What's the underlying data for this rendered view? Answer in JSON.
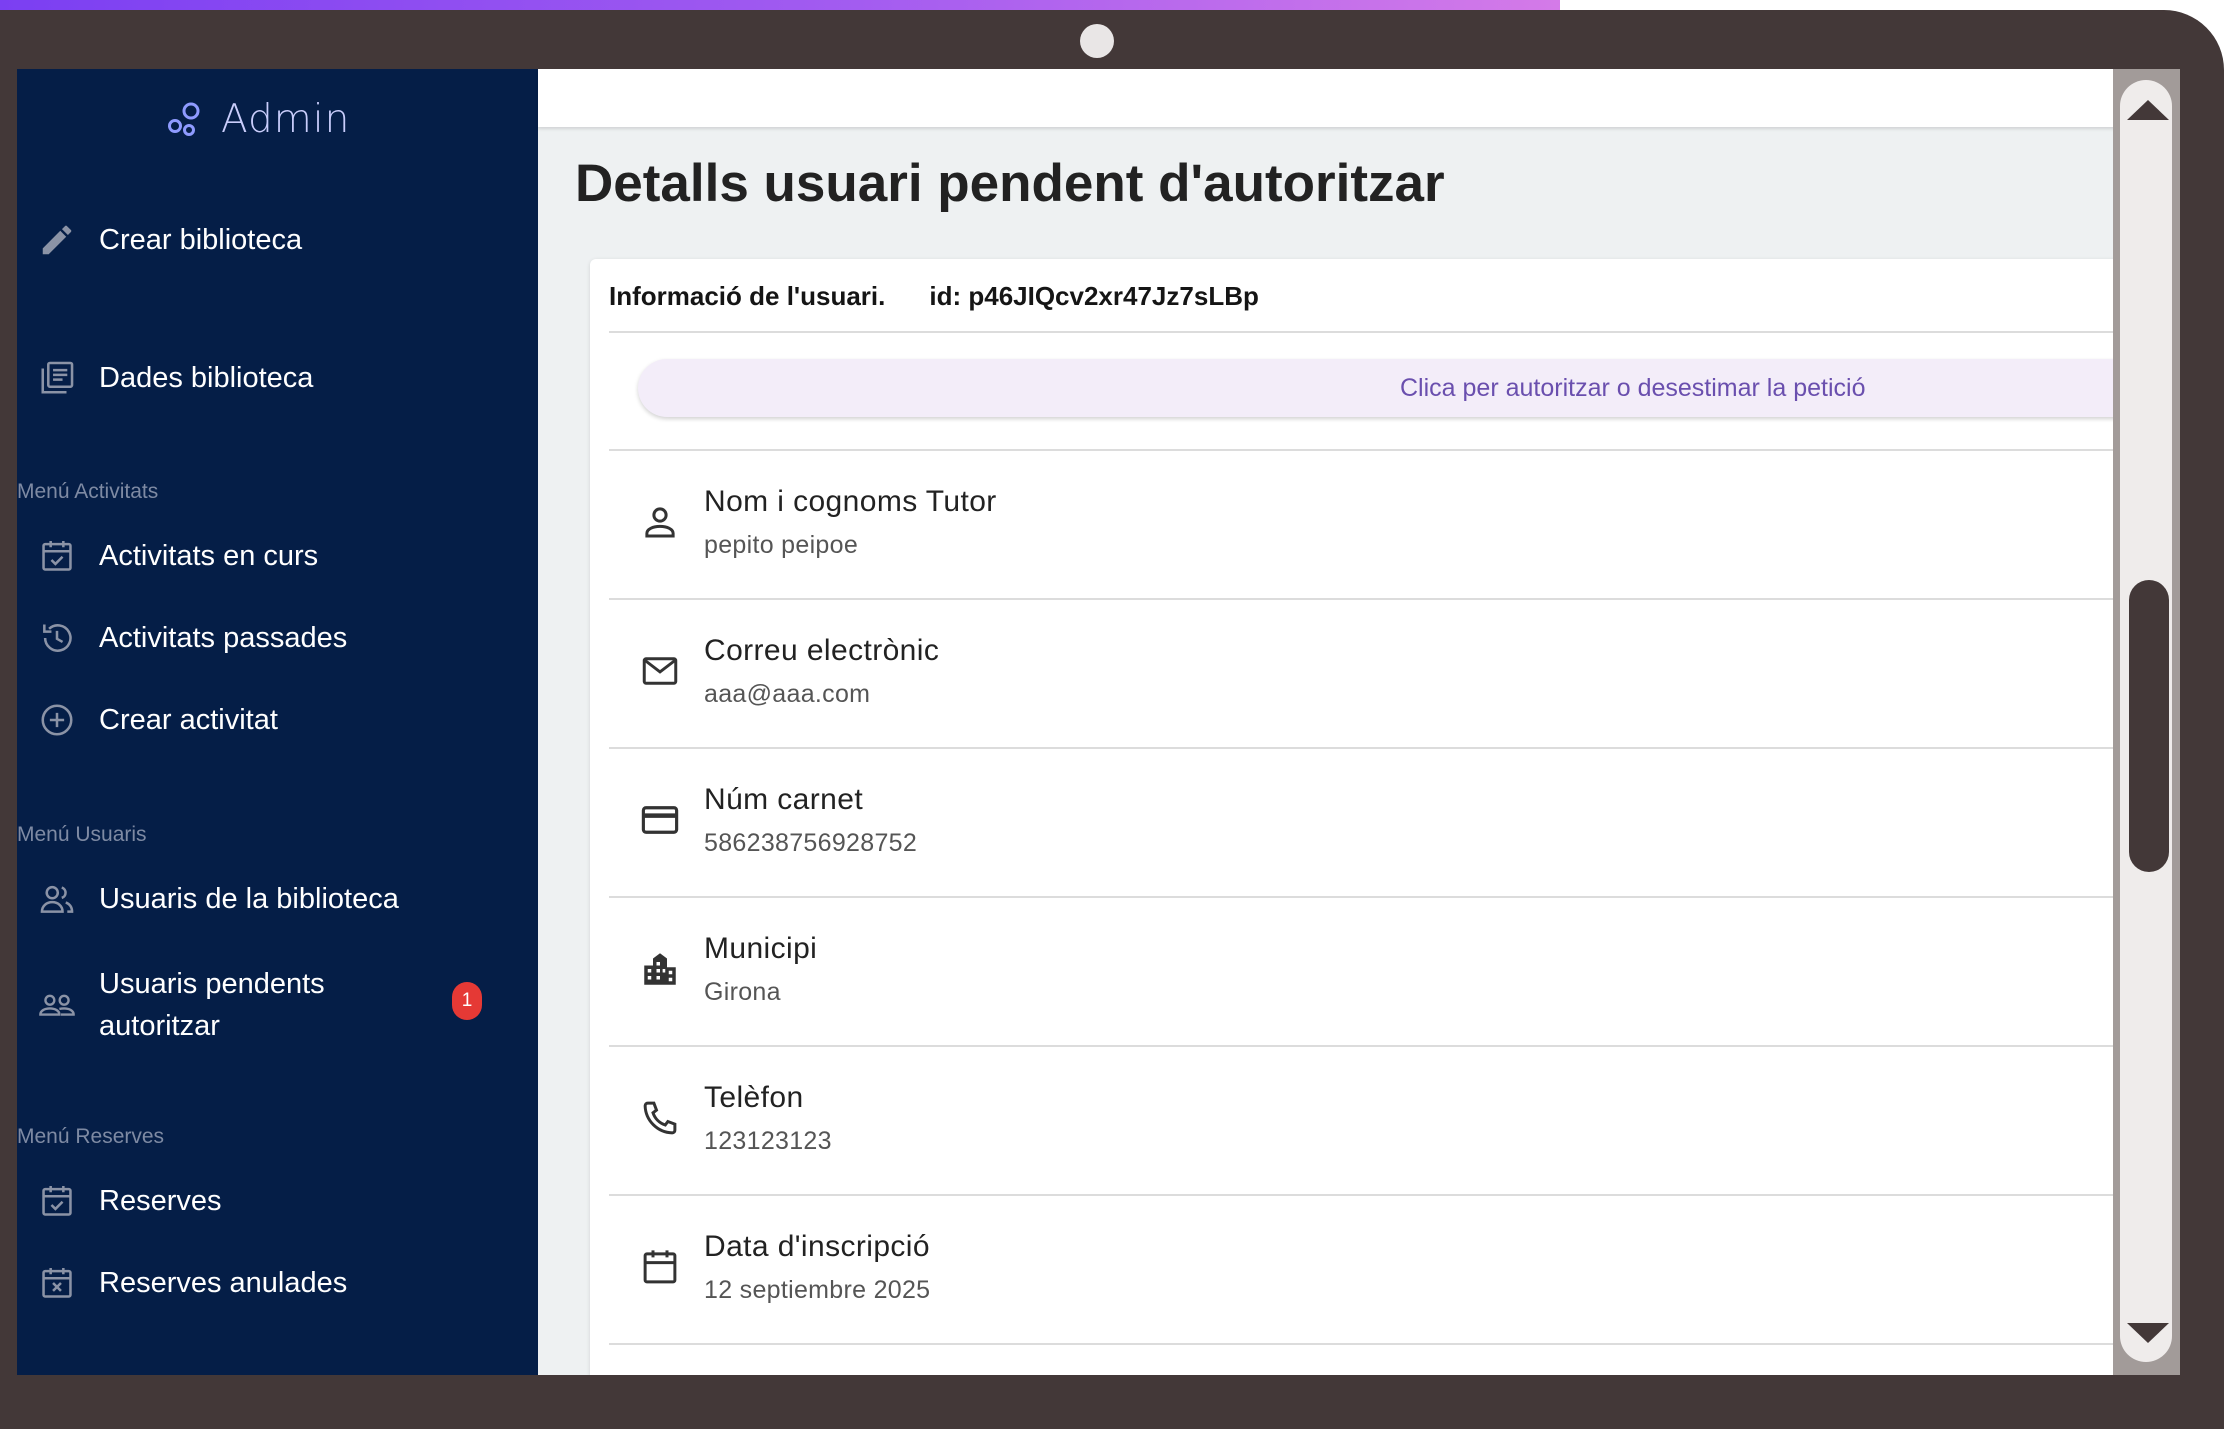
{
  "sidebar": {
    "brand": "Admin",
    "items": [
      {
        "label": "Crear biblioteca",
        "icon": "pencil-icon"
      },
      {
        "label": "Dades biblioteca",
        "icon": "library-books-icon"
      },
      {
        "label": "Activitats en curs",
        "icon": "event-available-icon"
      },
      {
        "label": "Activitats passades",
        "icon": "history-icon"
      },
      {
        "label": "Crear activitat",
        "icon": "add-circle-icon"
      },
      {
        "label": "Usuaris de la biblioteca",
        "icon": "group-icon"
      },
      {
        "label": "Usuaris pendents autoritzar",
        "icon": "people-outline-icon",
        "badge": "1"
      },
      {
        "label": "Reserves",
        "icon": "event-available-icon"
      },
      {
        "label": "Reserves anulades",
        "icon": "event-busy-icon"
      }
    ],
    "sections": {
      "activitats": "Menú Activitats",
      "usuaris": "Menú Usuaris",
      "reserves": "Menú Reserves"
    },
    "badge_color": "#e53935",
    "background": "#051e47"
  },
  "main": {
    "title": "Detalls usuari pendent d'autoritzar",
    "card": {
      "header": "Informació de l'usuari.",
      "id_text": "id: p46JIQcv2xr47Jz7sLBp",
      "action": "Clica per autoritzar o desestimar la petició",
      "fields": [
        {
          "label": "Nom i cognoms Tutor",
          "value": "pepito peipoe",
          "icon": "person-icon"
        },
        {
          "label": "Correu electrònic",
          "value": "aaa@aaa.com",
          "icon": "mail-icon"
        },
        {
          "label": "Núm carnet",
          "value": "586238756928752",
          "icon": "credit-card-icon"
        },
        {
          "label": "Municipi",
          "value": "Girona",
          "icon": "city-icon"
        },
        {
          "label": "Telèfon",
          "value": "123123123",
          "icon": "phone-icon"
        },
        {
          "label": "Data d'inscripció",
          "value": "12 septiembre 2025",
          "icon": "calendar-icon"
        }
      ]
    }
  }
}
